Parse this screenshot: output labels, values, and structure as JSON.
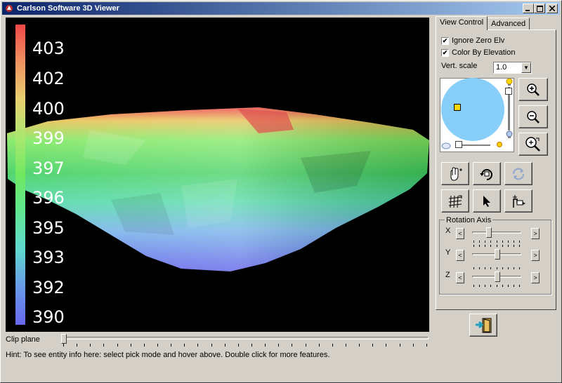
{
  "window": {
    "title": "Carlson Software 3D Viewer"
  },
  "legend": {
    "labels": [
      "403",
      "402",
      "400",
      "399",
      "397",
      "396",
      "395",
      "393",
      "392",
      "390"
    ]
  },
  "clip": {
    "label": "Clip plane"
  },
  "hint": "Hint: To see entity info here: select pick mode and hover above. Double click for more features.",
  "tabs": [
    {
      "label": "View Control"
    },
    {
      "label": "Advanced"
    }
  ],
  "options": {
    "ignore_zero": {
      "label": "Ignore Zero Elv",
      "checked": true
    },
    "color_by_elev": {
      "label": "Color By Elevation",
      "checked": true
    },
    "vert_scale": {
      "label": "Vert. scale",
      "value": "1.0"
    }
  },
  "rotation": {
    "title": "Rotation Axis",
    "axes": [
      "X",
      "Y",
      "Z"
    ]
  },
  "colors": {
    "title_start": "#0a246a",
    "title_end": "#a6caf0",
    "light_circle": "#87cef8",
    "viewport": "#000000"
  }
}
